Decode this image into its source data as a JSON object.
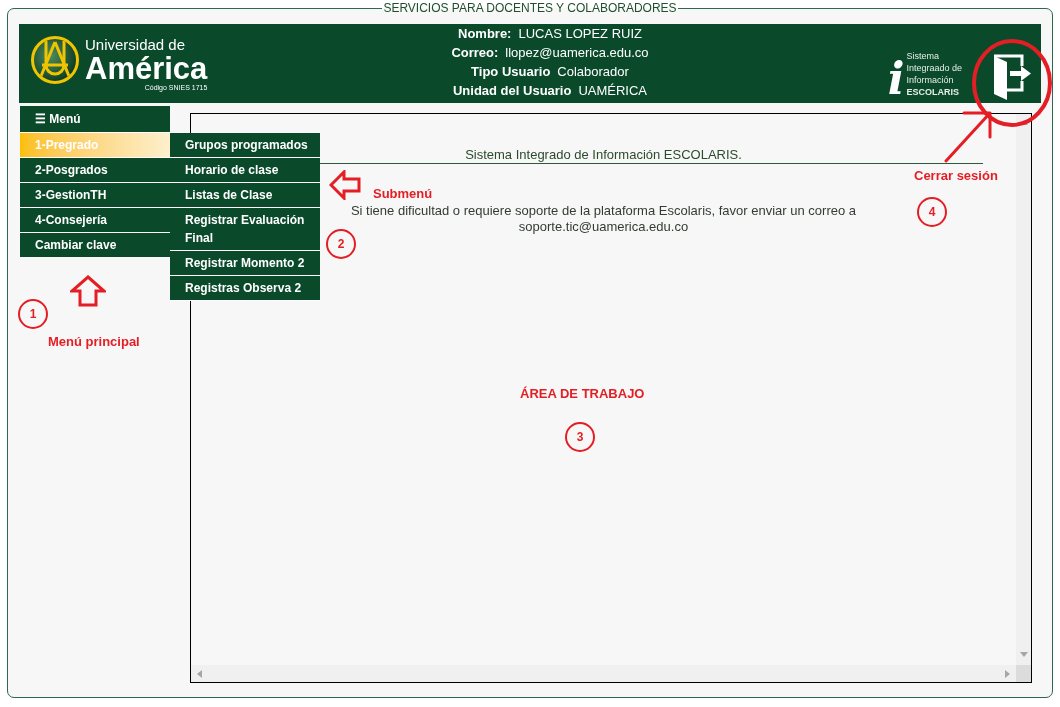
{
  "page_title": "SERVICIOS PARA DOCENTES Y COLABORADORES",
  "header": {
    "logo": {
      "upper": "Universidad de",
      "main": "América",
      "code": "Código SNIES 1715"
    },
    "user_info": [
      {
        "label": "Nombre:",
        "value": "LUCAS LOPEZ RUIZ"
      },
      {
        "label": "Correo:",
        "value": "llopez@uamerica.edu.co"
      },
      {
        "label": "Tipo Usuario",
        "value": "Colaborador"
      },
      {
        "label": "Unidad del Usuario",
        "value": "UAMÉRICA"
      }
    ],
    "system_logo": {
      "mark": "i",
      "name_lines": [
        "Sistema",
        "Integraado de",
        "Información",
        "**ESCOLARIS**"
      ]
    }
  },
  "menu": {
    "title": "☰ Menú",
    "items": [
      {
        "label": "1-Pregrado",
        "selected": true
      },
      {
        "label": "2-Posgrados",
        "selected": false
      },
      {
        "label": "3-GestionTH",
        "selected": false
      },
      {
        "label": "4-Consejería",
        "selected": false
      },
      {
        "label": "Cambiar clave",
        "selected": false
      }
    ]
  },
  "submenu": {
    "items": [
      {
        "label": "Grupos programados",
        "selected": false
      },
      {
        "label": "Horario de clase",
        "selected": false
      },
      {
        "label": "Listas de Clase",
        "selected": false
      },
      {
        "label": "Registrar Evaluación Final",
        "selected": false
      },
      {
        "label": "Registrar Momento 2",
        "selected": false
      },
      {
        "label": "Registras Observa 2",
        "selected": false
      }
    ]
  },
  "work_area": {
    "title": "Sistema Integrado de Información ESCOLARIS.",
    "message": {
      "text": "Si tiene dificultad o requiere soporte de la plataforma Escolaris, favor enviar un correo a",
      "email": "soporte.tic@uamerica.edu.co"
    }
  },
  "callouts": [
    {
      "number": "1",
      "label": "Menú principal",
      "arrow": {
        "kind": "up"
      },
      "ring": false
    },
    {
      "number": "2",
      "label": "Submenú",
      "arrow": {
        "kind": "left"
      },
      "ring": false
    },
    {
      "number": "3",
      "label": "ÁREA DE TRABAJO",
      "ring": false
    },
    {
      "number": "4",
      "label": "Cerrar sesión",
      "arrow": {
        "kind": "diagonal"
      },
      "ring": true
    }
  ]
}
